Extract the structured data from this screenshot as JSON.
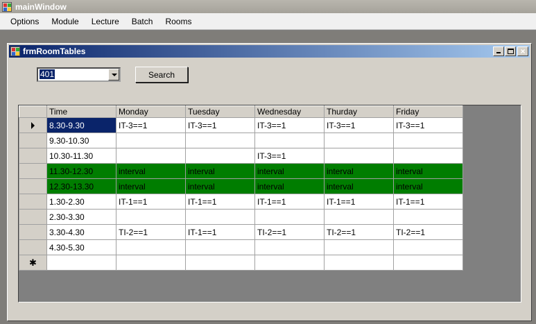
{
  "main_window": {
    "title": "mainWindow"
  },
  "menu": [
    "Options",
    "Module",
    "Lecture",
    "Batch",
    "Rooms"
  ],
  "child_form": {
    "title": "frmRoomTables"
  },
  "room_combo": {
    "value": "401"
  },
  "search_button": {
    "label": "Search"
  },
  "grid": {
    "columns": [
      "Time",
      "Monday",
      "Tuesday",
      "Wednesday",
      "Thurday",
      "Friday"
    ],
    "rows": [
      {
        "time": "8.30-9.30",
        "cells": [
          "IT-3==1",
          "IT-3==1",
          "IT-3==1",
          "IT-3==1",
          "IT-3==1"
        ]
      },
      {
        "time": "9.30-10.30",
        "cells": [
          "",
          "",
          "",
          "",
          ""
        ]
      },
      {
        "time": "10.30-11.30",
        "cells": [
          "",
          "",
          "IT-3==1",
          "",
          ""
        ]
      },
      {
        "time": "11.30-12.30",
        "cells": [
          "interval",
          "interval",
          "interval",
          "interval",
          "interval"
        ]
      },
      {
        "time": "12.30-13.30",
        "cells": [
          "interval",
          "interval",
          "interval",
          "interval",
          "interval"
        ]
      },
      {
        "time": "1.30-2.30",
        "cells": [
          "IT-1==1",
          "IT-1==1",
          "IT-1==1",
          "IT-1==1",
          "IT-1==1"
        ]
      },
      {
        "time": "2.30-3.30",
        "cells": [
          "",
          "",
          "",
          "",
          ""
        ]
      },
      {
        "time": "3.30-4.30",
        "cells": [
          "TI-2==1",
          "IT-1==1",
          "TI-2==1",
          "TI-2==1",
          "TI-2==1"
        ]
      },
      {
        "time": "4.30-5.30",
        "cells": [
          "",
          "",
          "",
          "",
          ""
        ]
      }
    ],
    "new_row_marker": "✱",
    "interval_color": "#007d00"
  }
}
